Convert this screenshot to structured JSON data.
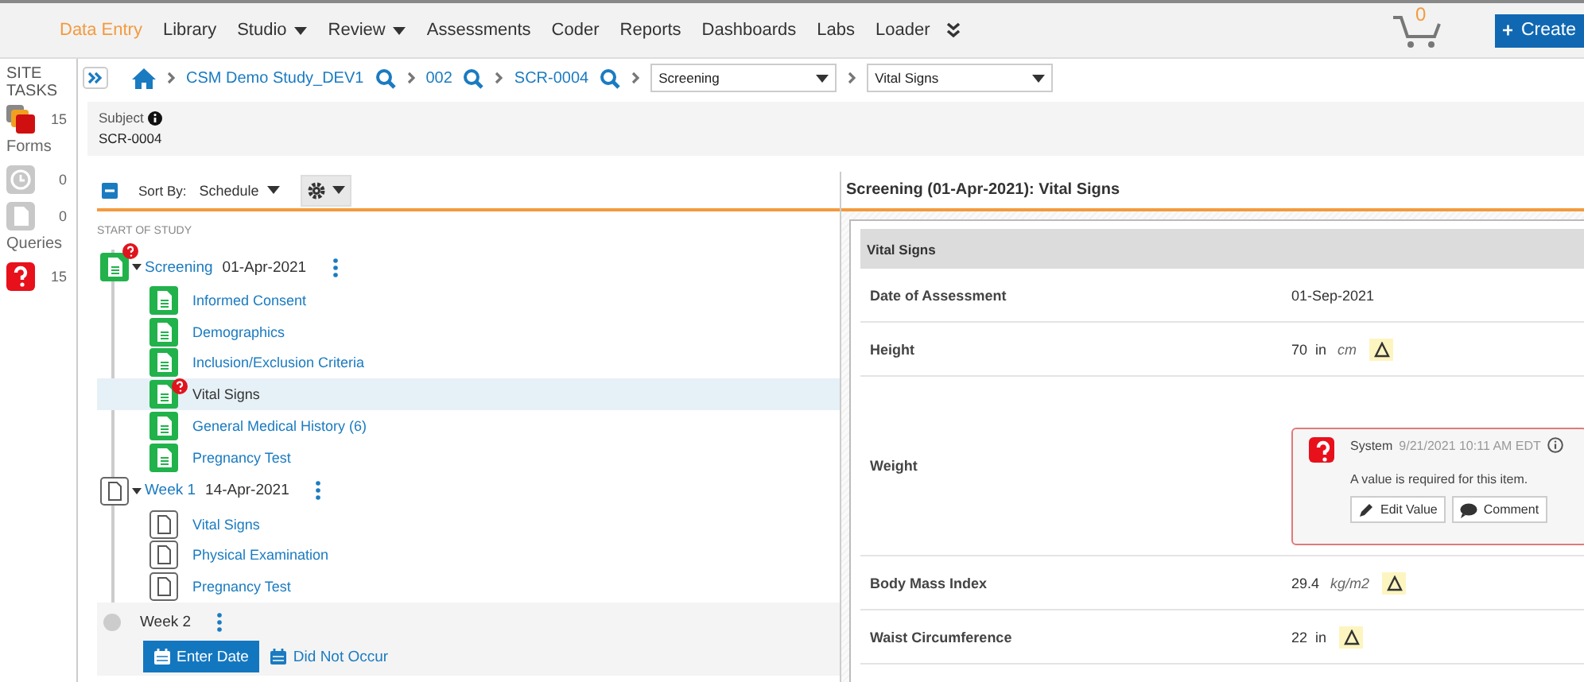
{
  "nav": {
    "items": [
      {
        "label": "Data Entry",
        "selected": true,
        "dropdown": false
      },
      {
        "label": "Library",
        "selected": false,
        "dropdown": false
      },
      {
        "label": "Studio",
        "selected": false,
        "dropdown": true
      },
      {
        "label": "Review",
        "selected": false,
        "dropdown": true
      },
      {
        "label": "Assessments",
        "selected": false,
        "dropdown": false
      },
      {
        "label": "Coder",
        "selected": false,
        "dropdown": false
      },
      {
        "label": "Reports",
        "selected": false,
        "dropdown": false
      },
      {
        "label": "Dashboards",
        "selected": false,
        "dropdown": false
      },
      {
        "label": "Labs",
        "selected": false,
        "dropdown": false
      },
      {
        "label": "Loader",
        "selected": false,
        "dropdown": false
      }
    ],
    "cart_count": "0",
    "create_label": "Create"
  },
  "sidebar": {
    "title": "SITE TASKS",
    "tasks_count": "15",
    "sections": [
      {
        "label": "Forms",
        "items": [
          {
            "kind": "clock",
            "count": "0"
          },
          {
            "kind": "form",
            "count": "0"
          }
        ]
      },
      {
        "label": "Queries",
        "items": [
          {
            "kind": "query",
            "count": "15"
          }
        ]
      }
    ]
  },
  "breadcrumb": {
    "items": [
      "CSM Demo Study_DEV1",
      "002",
      "SCR-0004"
    ],
    "event_select": "Screening",
    "form_select": "Vital Signs"
  },
  "subject": {
    "label": "Subject",
    "value": "SCR-0004"
  },
  "toolbar": {
    "sort_label": "Sort By:",
    "sort_value": "Schedule"
  },
  "tree": {
    "header": "START OF STUDY",
    "events": [
      {
        "kind": "visit",
        "name": "Screening",
        "date": "01-Apr-2021",
        "complete": true,
        "query": true,
        "expanded": true,
        "children": [
          {
            "name": "Informed Consent",
            "complete": true,
            "query": false,
            "selected": false
          },
          {
            "name": "Demographics",
            "complete": true,
            "query": false,
            "selected": false
          },
          {
            "name": "Inclusion/Exclusion Criteria",
            "complete": true,
            "query": false,
            "selected": false
          },
          {
            "name": "Vital Signs",
            "complete": true,
            "query": true,
            "selected": true
          },
          {
            "name": "General Medical History (6)",
            "complete": true,
            "query": false,
            "selected": false
          },
          {
            "name": "Pregnancy Test",
            "complete": true,
            "query": false,
            "selected": false
          }
        ]
      },
      {
        "kind": "visit",
        "name": "Week 1",
        "date": "14-Apr-2021",
        "complete": false,
        "query": false,
        "expanded": true,
        "children": [
          {
            "name": "Vital Signs",
            "complete": false,
            "query": false,
            "selected": false
          },
          {
            "name": "Physical Examination",
            "complete": false,
            "query": false,
            "selected": false
          },
          {
            "name": "Pregnancy Test",
            "complete": false,
            "query": false,
            "selected": false
          }
        ]
      },
      {
        "kind": "pending",
        "name": "Week 2",
        "actions": [
          "Enter Date",
          "Did Not Occur"
        ]
      }
    ]
  },
  "form": {
    "title": "Screening (01-Apr-2021): Vital Signs",
    "section": "Vital Signs",
    "rows": [
      {
        "label": "Date of Assessment",
        "value": "01-Sep-2021",
        "delta": false
      },
      {
        "label": "Height",
        "value": "70",
        "unit": "in",
        "alt_unit": "cm",
        "delta": true
      },
      {
        "label": "Weight",
        "delta": false,
        "query": {
          "author": "System",
          "time": "9/21/2021 10:11 AM EDT",
          "message": "A value is required for this item.",
          "actions": [
            "Edit Value",
            "Comment"
          ]
        }
      },
      {
        "label": "Body Mass Index",
        "value": "29.4",
        "alt_unit": "kg/m2",
        "delta": true
      },
      {
        "label": "Waist Circumference",
        "value": "22",
        "unit": "in",
        "delta": true
      }
    ]
  }
}
